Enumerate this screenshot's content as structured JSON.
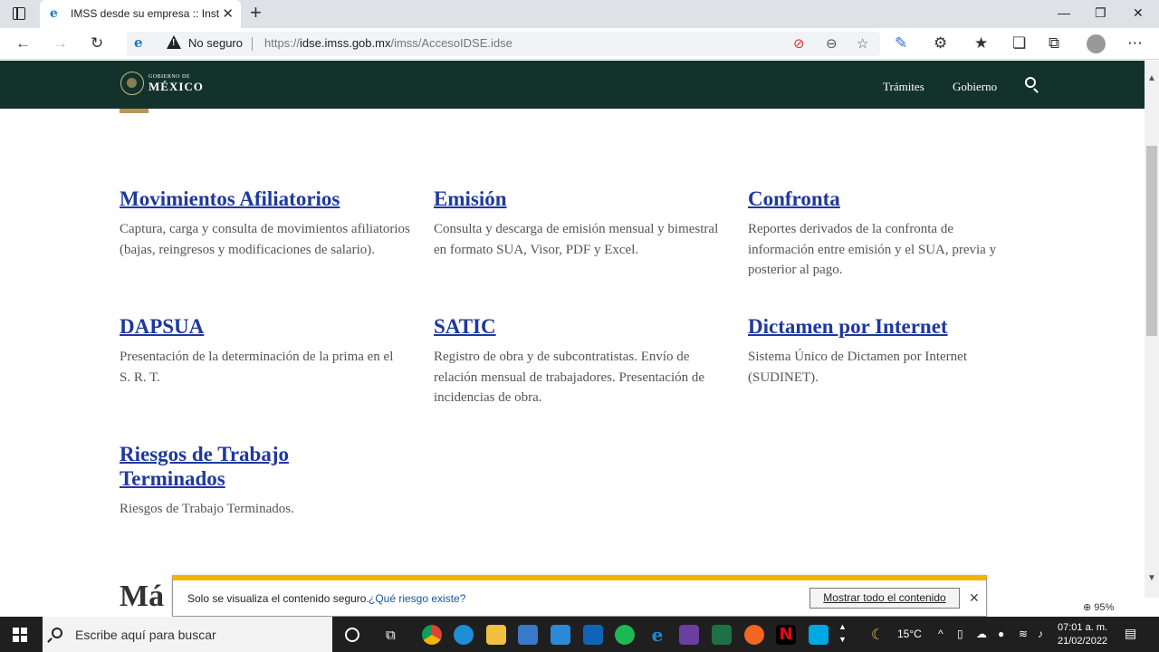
{
  "browser": {
    "tab_title": "IMSS desde su empresa :: Instituto Mexicano del Seguro Social",
    "security_label": "No seguro",
    "url_prefix": "https://",
    "url_domain": "idse.imss.gob.mx",
    "url_path": "/imss/AccesoIDSE.idse"
  },
  "gov_header": {
    "logo_small": "GOBIERNO DE",
    "logo_big": "MÉXICO",
    "nav": [
      "Trámites",
      "Gobierno"
    ]
  },
  "services": [
    {
      "title": "Movimientos Afiliatorios",
      "desc": "Captura, carga y consulta de movimientos afiliatorios (bajas, reingresos y modificaciones de salario)."
    },
    {
      "title": "Emisión",
      "desc": "Consulta y descarga de emisión mensual y bimestral en formato SUA, Visor, PDF y Excel."
    },
    {
      "title": "Confronta",
      "desc": "Reportes derivados de la confronta de información entre emisión y el SUA, previa y posterior al pago."
    },
    {
      "title": "DAPSUA",
      "desc": "Presentación de la determinación de la prima en el S. R. T."
    },
    {
      "title": "SATIC",
      "desc": "Registro de obra y de subcontratistas. Envío de relación mensual de trabajadores. Presentación de incidencias de obra."
    },
    {
      "title": "Dictamen por Internet",
      "desc": "Sistema Único de Dictamen por Internet (SUDINET)."
    },
    {
      "title": "Riesgos de Trabajo Terminados",
      "desc": "Riesgos de Trabajo Terminados."
    }
  ],
  "cutoff_heading": "Má",
  "notification": {
    "message": "Solo se visualiza el contenido seguro.",
    "link": "¿Qué riesgo existe?",
    "button": "Mostrar todo el contenido"
  },
  "zoom_level": "95%",
  "taskbar": {
    "search_placeholder": "Escribe aquí para buscar",
    "temperature": "15°C",
    "time": "07:01 a. m.",
    "date": "21/02/2022"
  },
  "colors": {
    "gov_green": "#13322b",
    "link_blue": "#1f38a0",
    "accent_gold": "#b5975a",
    "notif_yellow": "#f0b400"
  }
}
